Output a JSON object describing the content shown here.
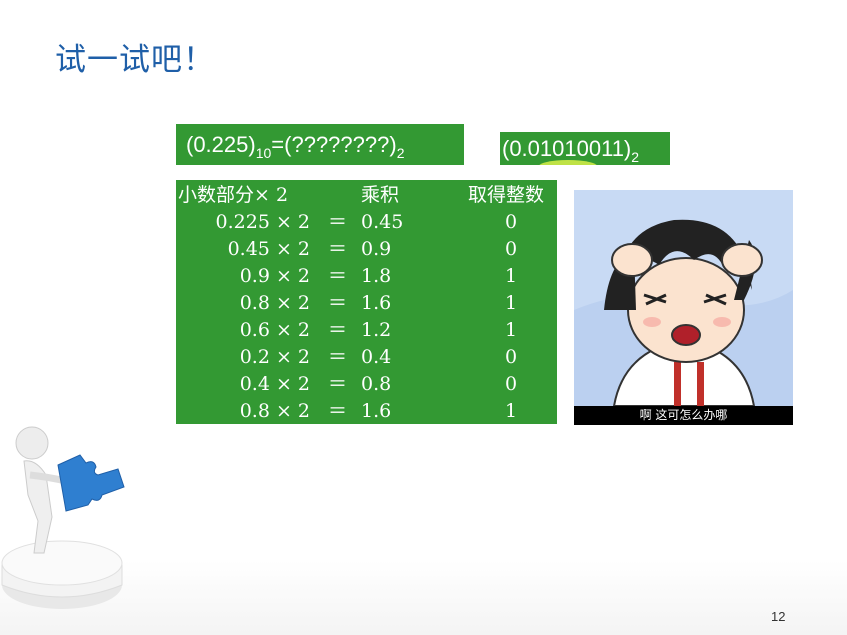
{
  "slide": {
    "title": "试一试吧！",
    "page_number": "12"
  },
  "equation": {
    "lhs": "(0.225)",
    "lhs_base": "10",
    "rhs": "=(????????)",
    "rhs_base": "2"
  },
  "answer": {
    "value": "(0.01010011)",
    "base": "2"
  },
  "conversion_table": {
    "headers": [
      "小数部分× 2",
      "乘积",
      "取得整数"
    ],
    "rows": [
      {
        "expr": "0.225 × 2",
        "eq": "＝",
        "product": "0.45",
        "digit": "0"
      },
      {
        "expr": "0.45 × 2",
        "eq": "＝",
        "product": "0.9",
        "digit": "0"
      },
      {
        "expr": "0.9 × 2",
        "eq": "＝",
        "product": "1.8",
        "digit": "1"
      },
      {
        "expr": "0.8 × 2",
        "eq": "＝",
        "product": "1.6",
        "digit": "1"
      },
      {
        "expr": "0.6 × 2",
        "eq": "＝",
        "product": "1.2",
        "digit": "1"
      },
      {
        "expr": "0.2 × 2",
        "eq": "＝",
        "product": "0.4",
        "digit": "0"
      },
      {
        "expr": "0.4 × 2",
        "eq": "＝",
        "product": "0.8",
        "digit": "0"
      },
      {
        "expr": "0.8 × 2",
        "eq": "＝",
        "product": "1.6",
        "digit": "1"
      }
    ]
  },
  "cartoon": {
    "caption": "啊 这可怎么办哪"
  },
  "colors": {
    "title": "#1f5fa8",
    "green_box": "#339933",
    "highlight": "#d8ee4a",
    "puzzle": "#2f7fd0"
  },
  "icons": [
    "figure-with-puzzle-icon",
    "cartoon-girl-frustrated-icon"
  ]
}
